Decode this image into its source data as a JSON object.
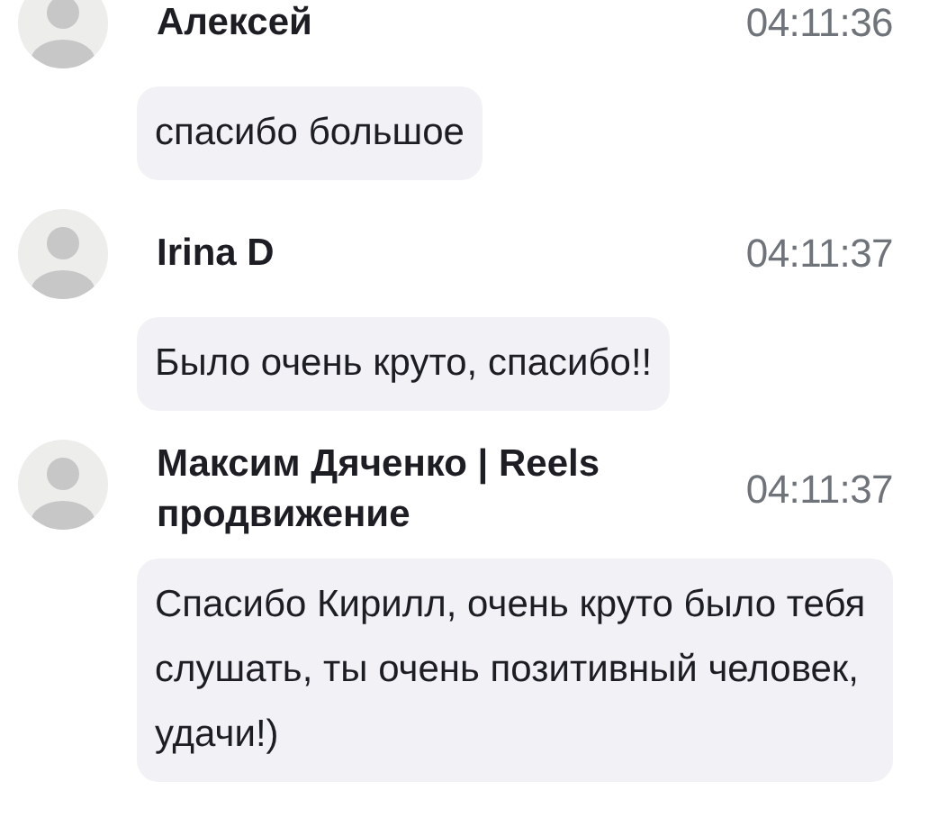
{
  "messages": [
    {
      "author": "Алексей",
      "time": "04:11:36",
      "text": "спасибо большое"
    },
    {
      "author": "Irina D",
      "time": "04:11:37",
      "text": "Было очень круто, спасибо!!"
    },
    {
      "author": "Максим Дяченко | Reels продвижение",
      "time": "04:11:37",
      "text": "Спасибо Кирилл, очень круто было тебя слушать, ты очень позитивный человек, удачи!)"
    }
  ]
}
